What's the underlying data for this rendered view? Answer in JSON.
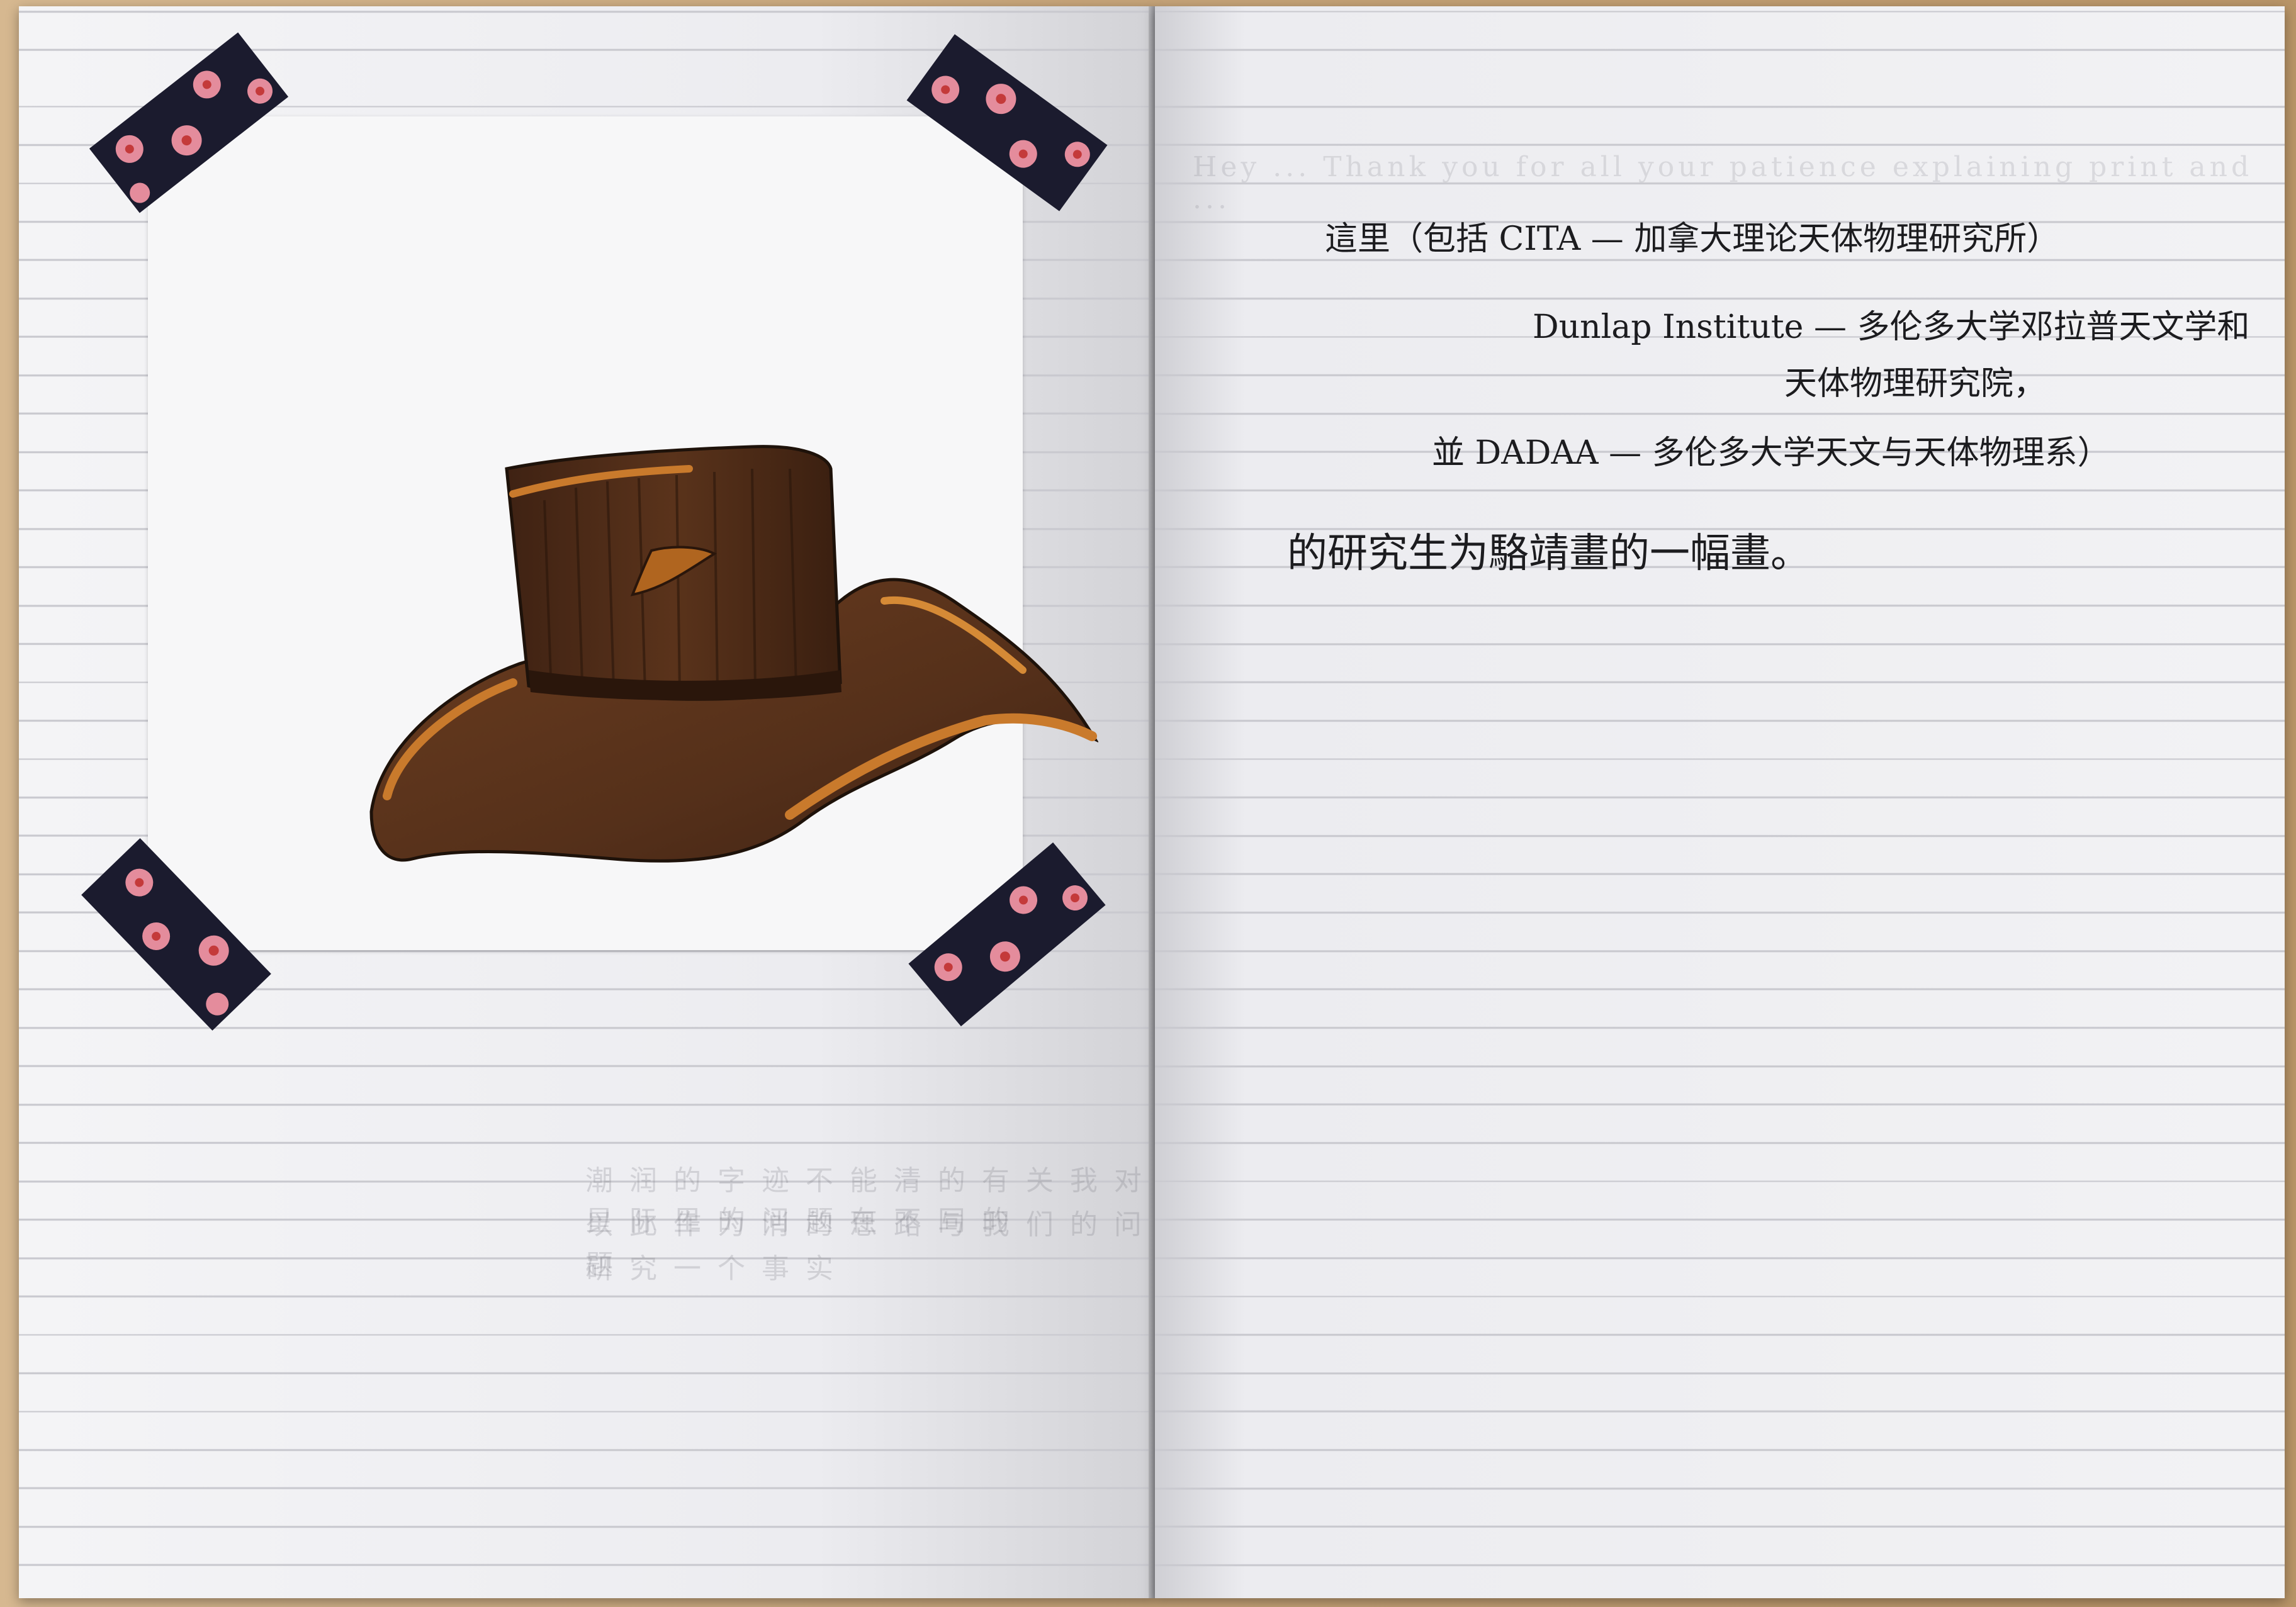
{
  "handwriting": {
    "line1": "這里（包括 CITA — 加拿大理论天体物理研究所）",
    "line2": "Dunlap Institute — 多伦多大学邓拉普天文学和",
    "line3": "天体物理研究院，",
    "line4": "並 DADAA — 多伦多大学天文与天体物理系）",
    "line5": "的研究生为駱靖畫的一幅畫。"
  },
  "colors": {
    "hat_dark": "#4a2a17",
    "hat_mid": "#6b3d1f",
    "hat_highlight": "#c97a2c",
    "tape_bg": "#1b1b2e",
    "flower_pink": "#e48c9c",
    "flower_center": "#c43a3a"
  }
}
